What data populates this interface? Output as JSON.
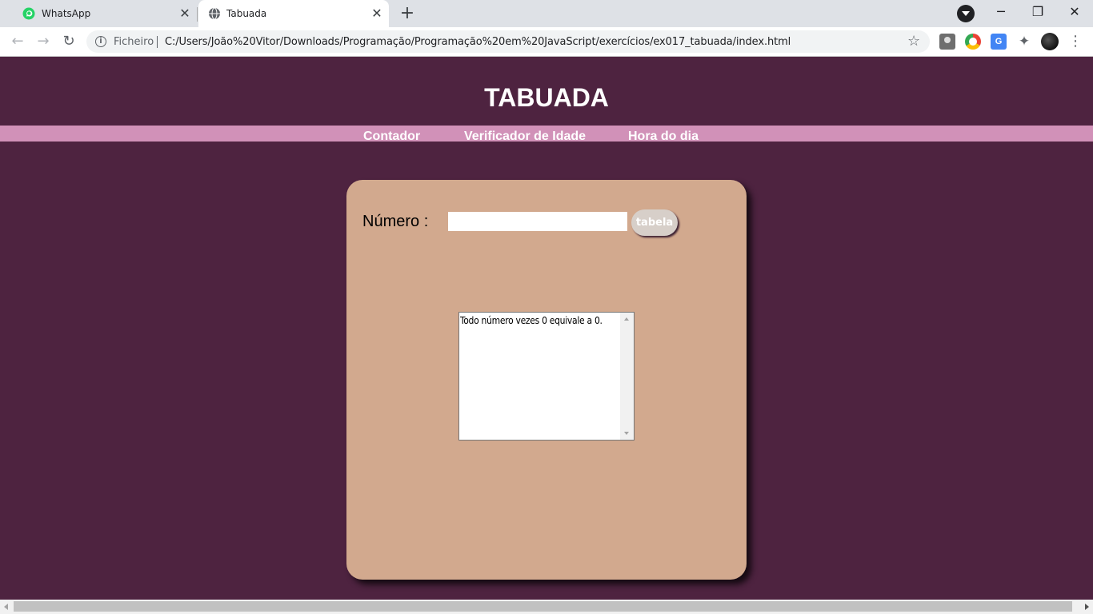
{
  "browser": {
    "tabs": [
      {
        "title": "WhatsApp",
        "favicon": "whatsapp-icon",
        "active": false
      },
      {
        "title": "Tabuada",
        "favicon": "globe-icon",
        "active": true
      }
    ],
    "scheme_label": "Ficheiro",
    "url": "C:/Users/João%20Vitor/Downloads/Programação/Programação%20em%20JavaScript/exercícios/ex017_tabuada/index.html",
    "colors": {
      "tabbar": "#dee1e6",
      "whatsapp": "#25d366"
    }
  },
  "page": {
    "title": "TABUADA",
    "nav": [
      "Contador",
      "Verificador de Idade",
      "Hora do dia"
    ],
    "form": {
      "label": "Número :",
      "input_value": "",
      "button_label": "tabela"
    },
    "result": {
      "text": "Todo número vezes 0 equivale a 0."
    },
    "colors": {
      "background": "#4e2340",
      "nav_bar": "#d191b8",
      "card": "#d2a98e",
      "button": "#d7cfc9"
    }
  }
}
